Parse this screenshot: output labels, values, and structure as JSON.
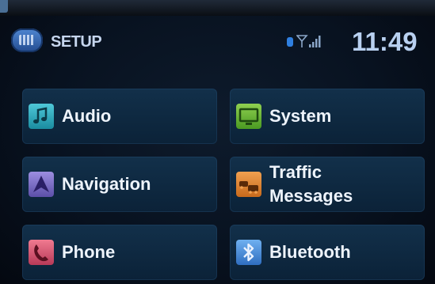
{
  "header": {
    "title": "SETUP",
    "clock": "11:49",
    "setup_icon": "setup-icon",
    "status_icons": [
      "bluetooth-status-icon",
      "signal-strength-icon"
    ]
  },
  "menu": {
    "items": [
      {
        "id": "audio",
        "lines": [
          "Audio"
        ],
        "icon": "music-note-icon"
      },
      {
        "id": "system",
        "lines": [
          "System"
        ],
        "icon": "monitor-icon"
      },
      {
        "id": "navigation",
        "lines": [
          "Navigation"
        ],
        "icon": "navigation-arrow-icon"
      },
      {
        "id": "traffic",
        "lines": [
          "Traffic",
          "Messages"
        ],
        "icon": "traffic-icon"
      },
      {
        "id": "phone",
        "lines": [
          "Phone"
        ],
        "icon": "phone-handset-icon"
      },
      {
        "id": "bluetooth",
        "lines": [
          "Bluetooth"
        ],
        "icon": "bluetooth-icon"
      }
    ]
  },
  "colors": {
    "background": "#081220",
    "tile": "#12304a",
    "text": "#eef4fc",
    "clock": "#b8d0f0"
  }
}
